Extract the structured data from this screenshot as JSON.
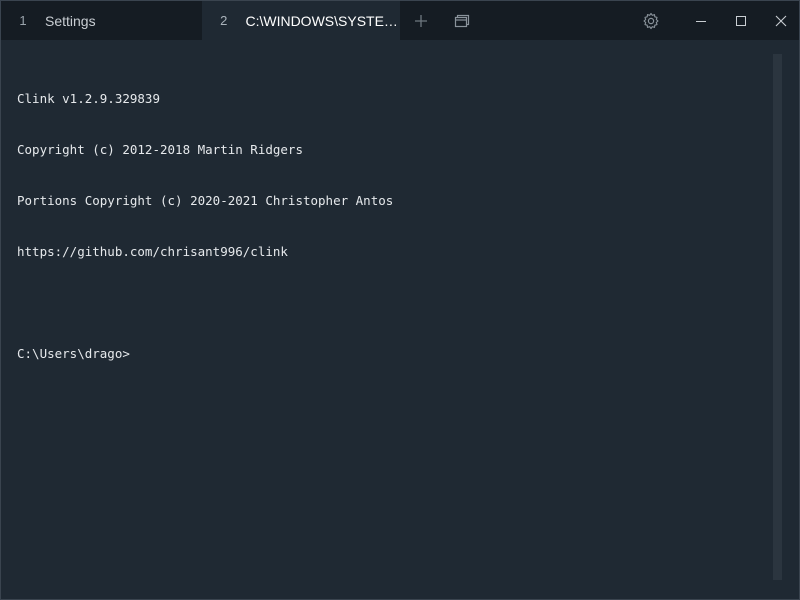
{
  "tabs": [
    {
      "number": "1",
      "title": "Settings"
    },
    {
      "number": "2",
      "title": "C:\\WINDOWS\\SYSTEM..."
    }
  ],
  "toolbar": {
    "new_tab_icon": "plus-icon",
    "tabs_view_icon": "tab-overview-icon",
    "settings_icon": "gear-icon",
    "minimize_icon": "minimize-icon",
    "maximize_icon": "maximize-icon",
    "close_icon": "close-icon"
  },
  "terminal": {
    "lines": [
      "Clink v1.2.9.329839",
      "Copyright (c) 2012-2018 Martin Ridgers",
      "Portions Copyright (c) 2020-2021 Christopher Antos",
      "https://github.com/chrisant996/clink",
      "",
      "C:\\Users\\drago>"
    ]
  },
  "colors": {
    "background": "#1f2933",
    "tabbar": "#151c23",
    "text": "#e6e9ec"
  }
}
